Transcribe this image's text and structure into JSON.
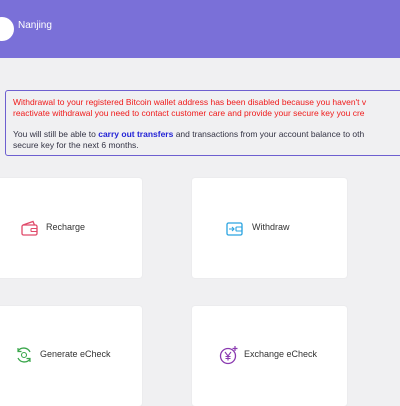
{
  "header": {
    "location": "Nanjing"
  },
  "notice": {
    "warning_line1": "Withdrawal to your registered Bitcoin wallet address has been disabled because you haven't v",
    "warning_line2": "reactivate withdrawal you need to contact customer care and provide your secure key you cre",
    "info_prefix": "You will still be able to ",
    "info_link": "carry out transfers",
    "info_suffix": " and transactions from your account balance to oth",
    "info_line2": "secure key for the next 6 months."
  },
  "actions": {
    "recharge": "Recharge",
    "withdraw": "Withdraw",
    "generate_echeck": "Generate eCheck",
    "exchange_echeck": "Exchange eCheck"
  },
  "icons": {
    "recharge": "wallet-icon",
    "withdraw": "withdraw-wallet-icon",
    "generate_echeck": "refresh-money-icon",
    "exchange_echeck": "yen-exchange-icon"
  },
  "colors": {
    "header": "#7a70d8",
    "warning_text": "#ef1a1a",
    "link": "#2323d6",
    "recharge_icon": "#e04a6a",
    "withdraw_icon": "#2aa3e0",
    "generate_icon": "#3aa64b",
    "exchange_icon": "#8a3ab0"
  }
}
